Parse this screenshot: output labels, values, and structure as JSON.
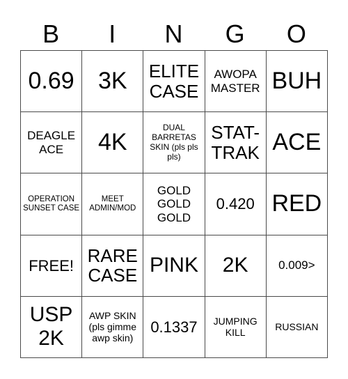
{
  "header": {
    "letters": [
      "B",
      "I",
      "N",
      "G",
      "O"
    ]
  },
  "grid": {
    "rows": [
      [
        "0.69",
        "3K",
        "ELITE CASE",
        "AWOPA MASTER",
        "BUH"
      ],
      [
        "DEAGLE ACE",
        "4K",
        "DUAL BARRETAS SKIN (pls pls pls)",
        "STAT-TRAK",
        "ACE"
      ],
      [
        "OPERATION SUNSET CASE",
        "MEET ADMIN/MOD",
        "GOLD GOLD GOLD",
        "0.420",
        "RED"
      ],
      [
        "FREE!",
        "RARE CASE",
        "PINK",
        "2K",
        "0.009>"
      ],
      [
        "USP 2K",
        "AWP SKIN (pls gimme awp skin)",
        "0.1337",
        "JUMPING KILL",
        "RUSSIAN"
      ]
    ]
  }
}
